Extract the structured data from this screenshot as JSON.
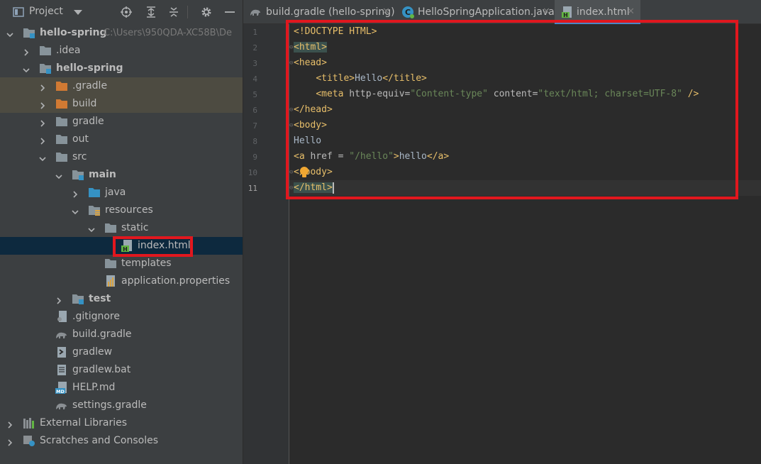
{
  "panel": {
    "title": "Project",
    "tree": [
      {
        "label": "hello-spring",
        "bold": true,
        "path": "C:\\Users\\950QDA-XC58B\\De",
        "chev": "down",
        "icon": "module-folder-icon"
      },
      {
        "label": ".idea",
        "chev": "right",
        "icon": "folder-icon"
      },
      {
        "label": "hello-spring",
        "bold": true,
        "chev": "down",
        "icon": "module-folder-icon"
      },
      {
        "label": ".gradle",
        "chev": "right",
        "icon": "excluded-folder-icon"
      },
      {
        "label": "build",
        "chev": "right",
        "icon": "excluded-folder-icon"
      },
      {
        "label": "gradle",
        "chev": "right",
        "icon": "folder-icon"
      },
      {
        "label": "out",
        "chev": "right",
        "icon": "folder-icon"
      },
      {
        "label": "src",
        "chev": "down",
        "icon": "folder-icon"
      },
      {
        "label": "main",
        "bold": true,
        "chev": "down",
        "icon": "module-folder-icon"
      },
      {
        "label": "java",
        "chev": "right",
        "icon": "source-folder-icon"
      },
      {
        "label": "resources",
        "chev": "down",
        "icon": "resources-folder-icon"
      },
      {
        "label": "static",
        "chev": "down",
        "icon": "folder-icon"
      },
      {
        "label": "index.html",
        "icon": "html-file-icon"
      },
      {
        "label": "templates",
        "icon": "folder-icon"
      },
      {
        "label": "application.properties",
        "icon": "properties-file-icon"
      },
      {
        "label": "test",
        "bold": true,
        "chev": "right",
        "icon": "module-folder-icon"
      },
      {
        "label": ".gitignore",
        "icon": "gitignore-file-icon"
      },
      {
        "label": "build.gradle",
        "icon": "gradle-file-icon"
      },
      {
        "label": "gradlew",
        "icon": "script-file-icon"
      },
      {
        "label": "gradlew.bat",
        "icon": "text-file-icon"
      },
      {
        "label": "HELP.md",
        "icon": "markdown-file-icon"
      },
      {
        "label": "settings.gradle",
        "icon": "gradle-file-icon"
      },
      {
        "label": "External Libraries",
        "chev": "right",
        "icon": "library-icon"
      },
      {
        "label": "Scratches and Consoles",
        "chev": "right",
        "icon": "scratches-icon"
      }
    ]
  },
  "tabs": [
    {
      "label": "build.gradle (hello-spring)",
      "icon": "gradle-file-icon"
    },
    {
      "label": "HelloSpringApplication.java",
      "icon": "java-class-icon"
    },
    {
      "label": "index.html",
      "icon": "html-file-icon",
      "active": true
    }
  ],
  "editor": {
    "line_numbers": [
      "1",
      "2",
      "3",
      "4",
      "5",
      "6",
      "7",
      "8",
      "9",
      "10",
      "11"
    ],
    "current_line": "11",
    "lines": [
      [
        "<!DOCTYPE HTML>"
      ],
      [
        "<html>"
      ],
      [
        "<head>"
      ],
      [
        "    ",
        "<title>",
        "Hello",
        "</title>"
      ],
      [
        "    ",
        "<meta ",
        "http-equiv=",
        "\"Content-type\"",
        " content=",
        "\"text/html; charset=UTF-8\"",
        " />"
      ],
      [
        "</head>"
      ],
      [
        "<body>"
      ],
      [
        "Hello"
      ],
      [
        "<a ",
        "href = ",
        "\"/hello\"",
        ">",
        "hello",
        "</a>"
      ],
      [
        "</body>"
      ],
      [
        "</html>"
      ]
    ]
  },
  "colors": {
    "tag": "#e8bf6a",
    "string": "#6a8759",
    "attribute": "#bababa",
    "text": "#a9b7c6",
    "highlight_box": "#e1171e",
    "selection": "#0d293e"
  }
}
